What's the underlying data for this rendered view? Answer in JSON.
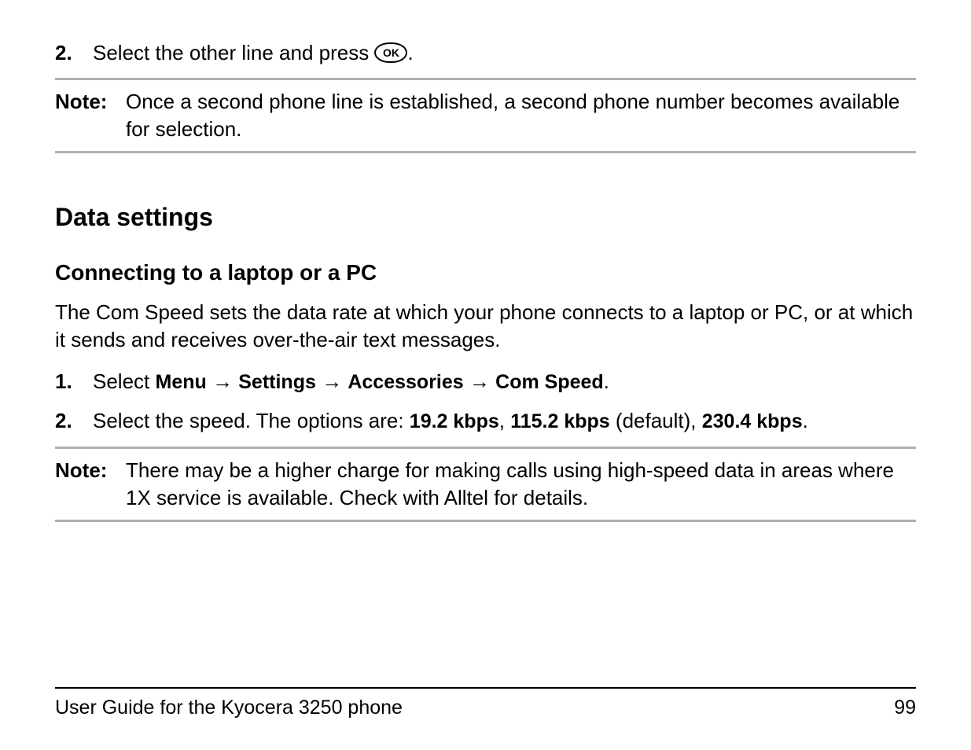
{
  "step_top": {
    "num": "2.",
    "text_before": "Select the other line and press ",
    "ok_label": "OK",
    "text_after": "."
  },
  "note1": {
    "label": "Note:",
    "text": "Once a second phone line is established, a second phone number becomes available for selection."
  },
  "heading1": "Data settings",
  "heading2": "Connecting to a laptop or a PC",
  "intro": "The Com Speed sets the data rate at which your phone connects to a laptop or PC, or at which it sends and receives over-the-air text messages.",
  "step1": {
    "num": "1.",
    "prefix": "Select ",
    "menu": "Menu",
    "settings": "Settings",
    "accessories": "Accessories",
    "comspeed": "Com Speed",
    "period": "."
  },
  "step2": {
    "num": "2.",
    "prefix": "Select the speed. The options are: ",
    "opt1": "19.2 kbps",
    "sep1": ", ",
    "opt2": "115.2 kbps",
    "default": " (default), ",
    "opt3": "230.4 kbps",
    "period": "."
  },
  "note2": {
    "label": "Note:",
    "text": "There may be a higher charge for making calls using high-speed data in areas where 1X service is available. Check with Alltel for details."
  },
  "footer": {
    "title": "User Guide for the Kyocera 3250 phone",
    "page": "99"
  }
}
